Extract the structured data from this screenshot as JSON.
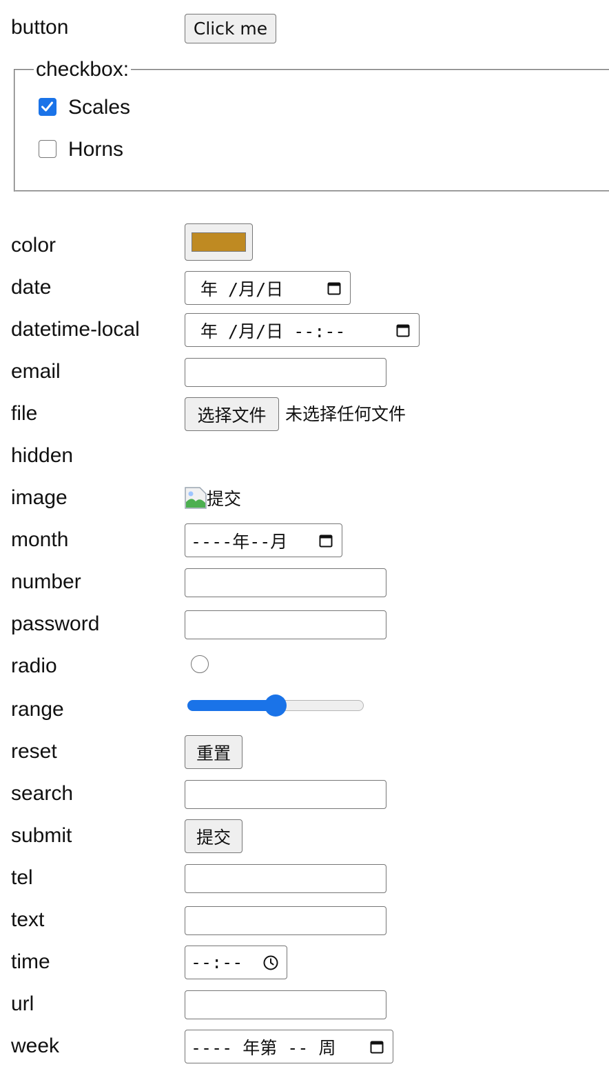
{
  "labels": {
    "button": "button",
    "color": "color",
    "date": "date",
    "datetime_local": "datetime-local",
    "email": "email",
    "file": "file",
    "hidden": "hidden",
    "image": "image",
    "month": "month",
    "number": "number",
    "password": "password",
    "radio": "radio",
    "range": "range",
    "reset": "reset",
    "search": "search",
    "submit": "submit",
    "tel": "tel",
    "text": "text",
    "time": "time",
    "url": "url",
    "week": "week"
  },
  "button": {
    "label": "Click me"
  },
  "checkbox_group": {
    "legend": "checkbox:",
    "items": [
      {
        "label": "Scales",
        "checked": true
      },
      {
        "label": "Horns",
        "checked": false
      }
    ]
  },
  "color_input": {
    "value_color": "#bf8a22"
  },
  "date_input": {
    "display": "年 /月/日"
  },
  "datetime_input": {
    "display": "年 /月/日 --:--"
  },
  "file_input": {
    "button_label": "选择文件",
    "status": "未选择任何文件"
  },
  "image_input": {
    "alt": "提交"
  },
  "month_input": {
    "display": "----年--月"
  },
  "radio_input": {
    "checked": false
  },
  "range_input": {
    "value_fraction": 0.5,
    "accent": "#1a73e8"
  },
  "reset_input": {
    "label": "重置"
  },
  "submit_input": {
    "label": "提交"
  },
  "time_input": {
    "display": "--:--"
  },
  "week_input": {
    "display": "---- 年第 -- 周"
  },
  "colors": {
    "accent": "#1a73e8",
    "border": "#767676",
    "button_bg": "#efefef"
  }
}
